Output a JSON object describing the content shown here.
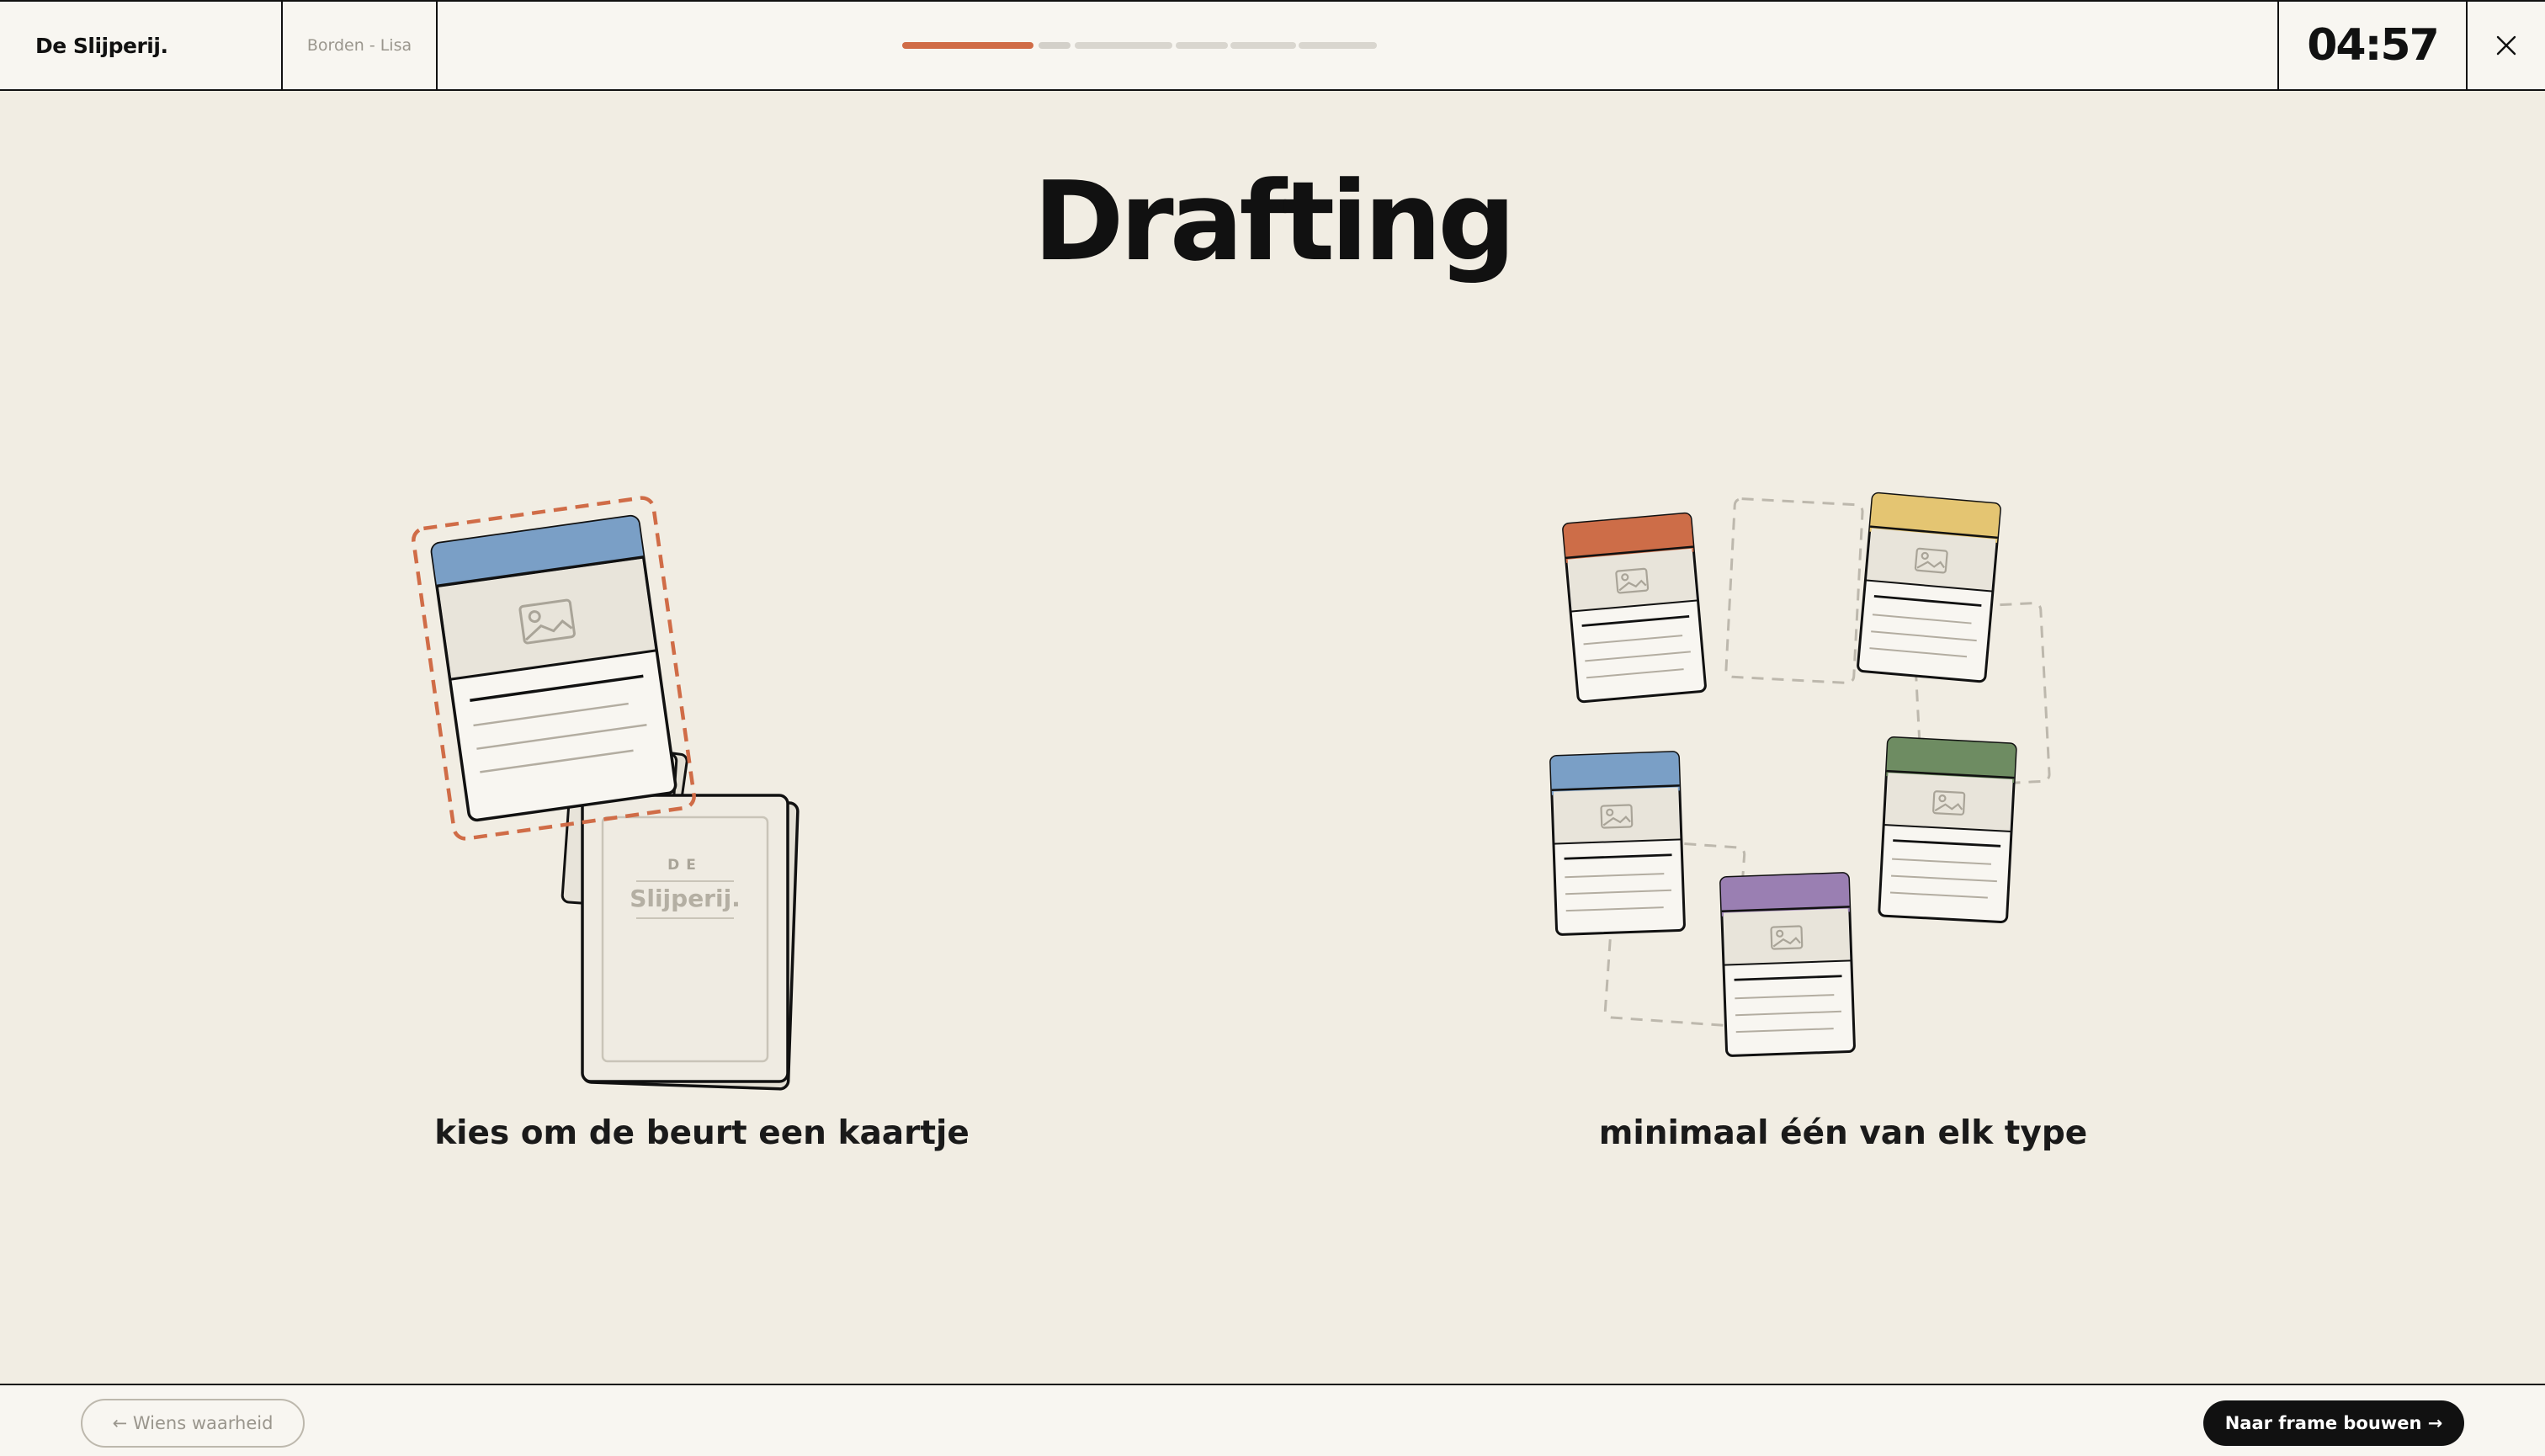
{
  "header": {
    "brand": "De Slijperij.",
    "breadcrumb": "Borden - Lisa",
    "timer": "04:57",
    "progress": {
      "active_color": "#d06c47",
      "current_color": "#d3d0c9",
      "pending_color": "#d9d6cf",
      "steps_total": 6,
      "steps_completed": 1,
      "current_step": 2
    },
    "close_icon": "close-icon"
  },
  "main": {
    "title": "Drafting",
    "left_caption": "kies om de beurt een kaartje",
    "right_caption": "minimaal één van elk type",
    "deck_label_top": "DE",
    "deck_label_brand": "Slijperij."
  },
  "card_colors": {
    "orange": "#cd6d48",
    "yellow": "#e4c572",
    "blue": "#7a9fc6",
    "green": "#6e8c62",
    "purple": "#9a7fb2",
    "highlight": "#d06c47"
  },
  "footer": {
    "back_label": "← Wiens waarheid",
    "next_label": "Naar frame bouwen →"
  }
}
